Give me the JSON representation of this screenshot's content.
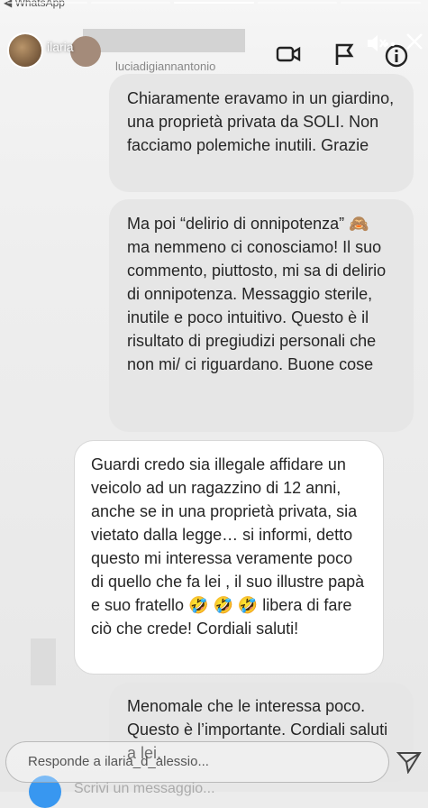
{
  "status_bar": {
    "back_app": "◀ WhatsApp"
  },
  "header": {
    "story_user": "ilaria",
    "dm_handle": "luciadigiannantonio",
    "icons": [
      "video-call-icon",
      "flag-icon",
      "mute-icon",
      "info-icon",
      "more-icon",
      "close-icon"
    ]
  },
  "messages": [
    {
      "style": "grey",
      "text": "Chiaramente eravamo in un giardino, una proprietà privata da SOLI. Non facciamo polemiche inutili. Grazie"
    },
    {
      "style": "grey",
      "text": "Ma poi “delirio di onnipotenza” 🙈 ma nemmeno ci conosciamo! Il suo commento, piuttosto, mi sa di delirio di onnipotenza. Messaggio sterile, inutile e poco intuitivo. Questo è il risultato di pregiudizi personali che non mi/ ci riguardano. Buone cose"
    },
    {
      "style": "white",
      "text": "Guardi credo sia illegale affidare un veicolo ad un ragazzino di 12 anni, anche se in una proprietà privata, sia vietato dalla legge… si informi, detto questo mi interessa veramente poco di quello che fa lei , il suo illustre papà e suo fratello 🤣 🤣 🤣 libera di fare ciò che crede! Cordiali saluti!"
    },
    {
      "style": "grey",
      "text": "Menomale che le interessa poco. Questo è l’importante. Cordiali saluti a lei."
    }
  ],
  "reply": {
    "placeholder": "Responde a ilaria_d_alessio..."
  },
  "underlying": {
    "input_placeholder": "Scrivi un messaggio..."
  }
}
